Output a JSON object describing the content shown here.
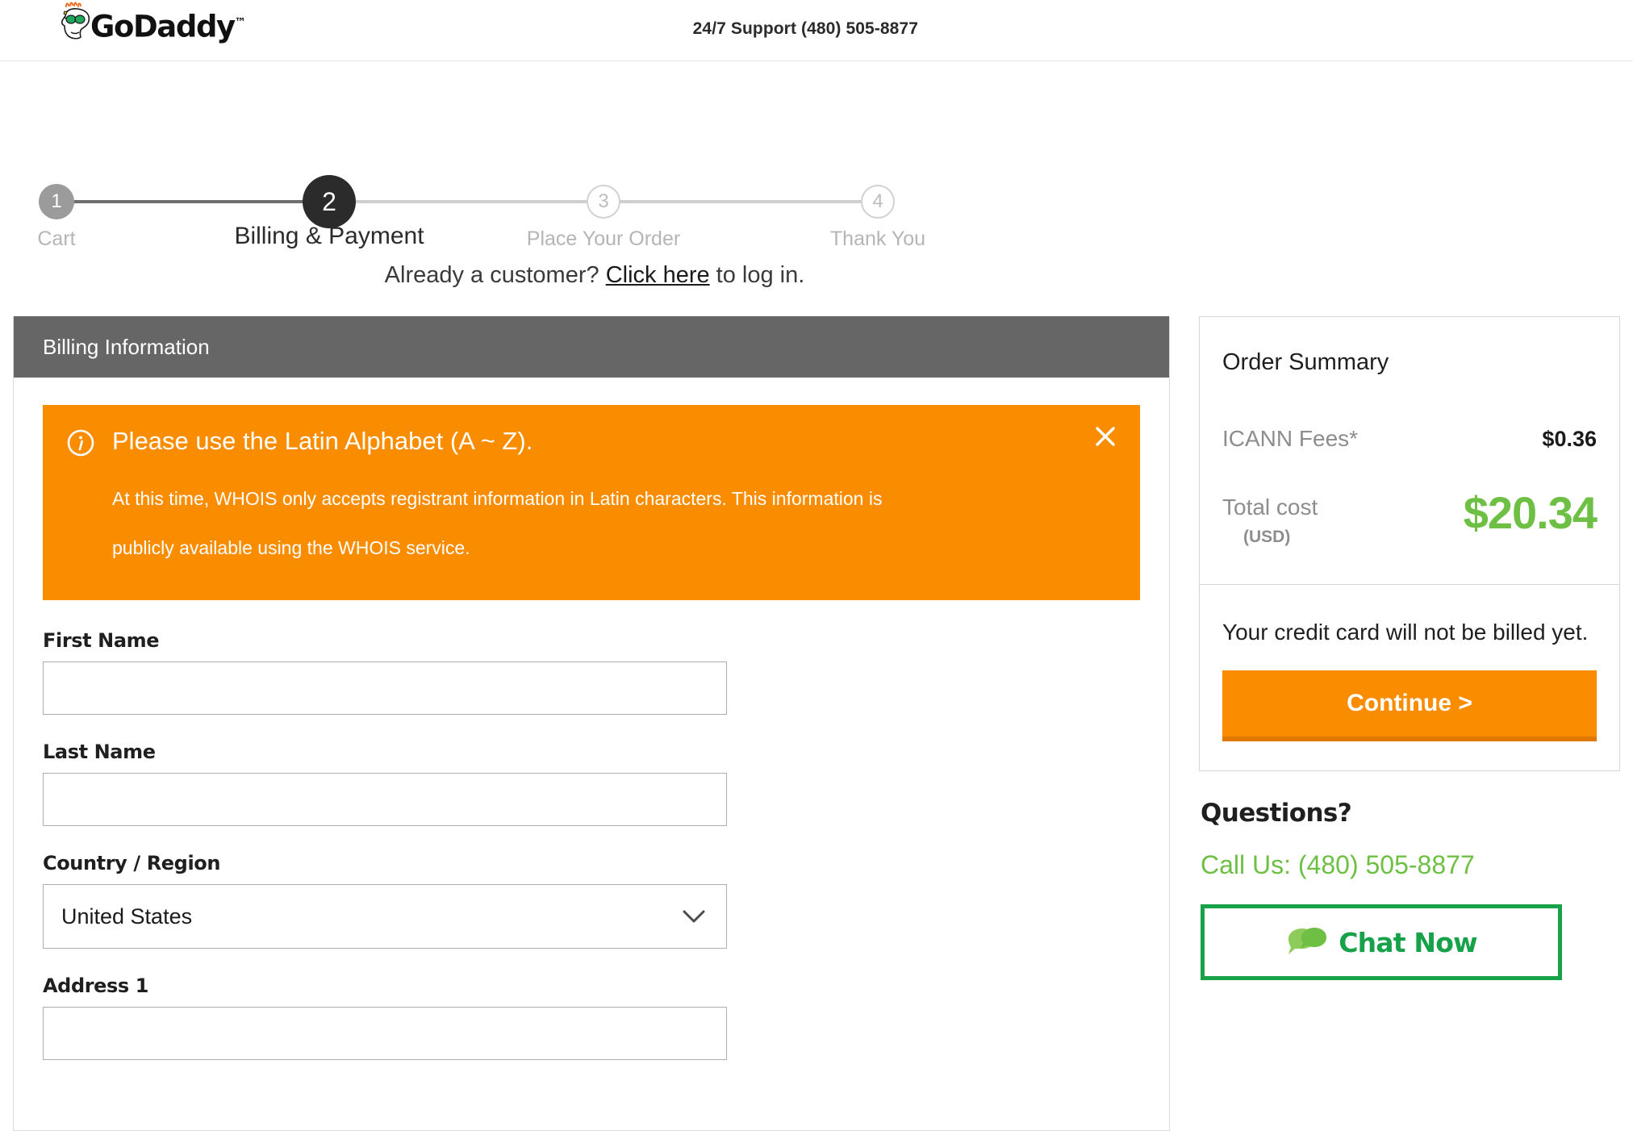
{
  "header": {
    "logo_text": "GoDaddy",
    "logo_tm": "™",
    "support": "24/7 Support  (480) 505-8877"
  },
  "stepper": {
    "steps": [
      {
        "number": "1",
        "label": "Cart",
        "state": "done"
      },
      {
        "number": "2",
        "label": "Billing & Payment",
        "state": "current"
      },
      {
        "number": "3",
        "label": "Place Your Order",
        "state": "todo"
      },
      {
        "number": "4",
        "label": "Thank You",
        "state": "todo"
      }
    ]
  },
  "login_prompt": {
    "before": "Already a customer? ",
    "link": "Click here",
    "after": " to log in."
  },
  "billing": {
    "panel_title": "Billing Information",
    "alert": {
      "title": "Please use the Latin Alphabet (A ~ Z).",
      "body": "At this time, WHOIS only accepts registrant information in Latin characters. This information is publicly available using the WHOIS service.",
      "icon": "info-circle-icon",
      "close_icon": "close-icon",
      "color": "#FA8C00"
    },
    "fields": [
      {
        "label": "First Name",
        "value": "",
        "placeholder": ""
      },
      {
        "label": "Last Name",
        "value": "",
        "placeholder": ""
      }
    ],
    "country": {
      "label": "Country / Region",
      "value": "United States",
      "chevron_icon": "chevron-down-icon"
    },
    "address1": {
      "label": "Address 1",
      "value": "",
      "placeholder": ""
    }
  },
  "order_summary": {
    "title": "Order Summary",
    "icann_label": "ICANN Fees*",
    "icann_value": "$0.36",
    "total_label": "Total cost",
    "total_currency": "(USD)",
    "total_value": "$20.34",
    "total_color": "#6EC044",
    "billed_note": "Your credit card will not be billed yet.",
    "continue_label": "Continue >"
  },
  "questions": {
    "title": "Questions?",
    "call_us": "Call Us: (480) 505-8877",
    "chat_label": "Chat Now",
    "chat_icon": "chat-bubbles-icon",
    "green": "#17A24A"
  }
}
